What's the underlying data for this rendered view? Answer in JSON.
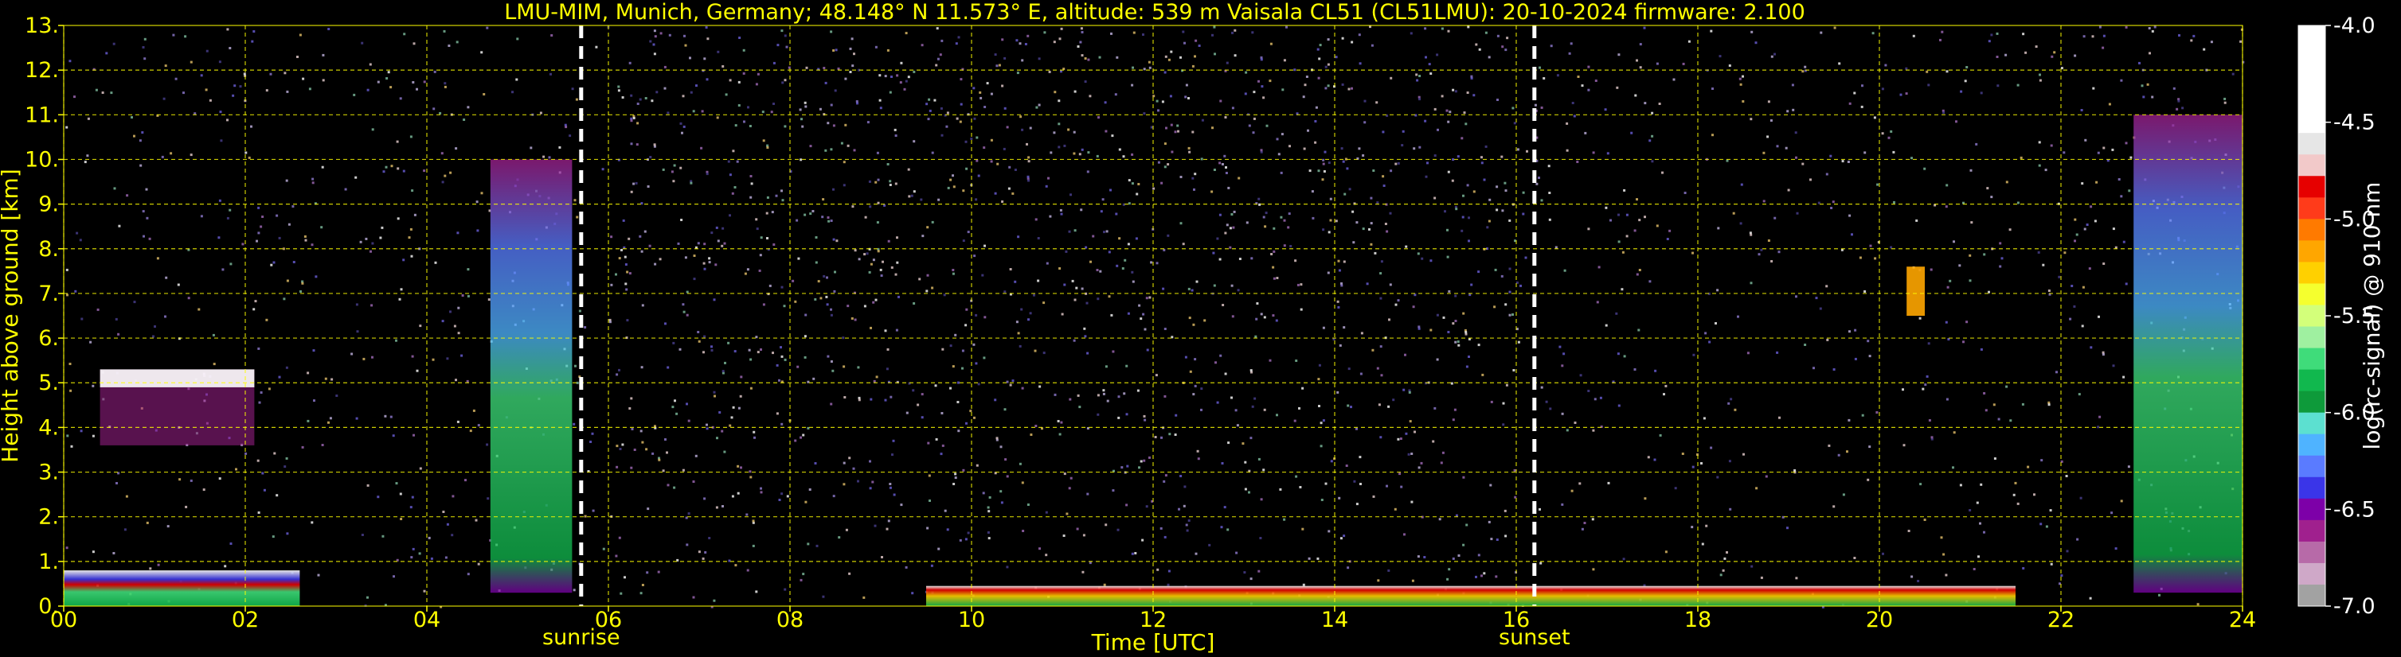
{
  "chart_data": {
    "type": "heatmap",
    "title": "LMU-MIM, Munich, Germany; 48.148° N 11.573° E, altitude: 539 m    Vaisala CL51 (CL51LMU): 20-10-2024    firmware: 2.100",
    "xlabel": "Time [UTC]",
    "ylabel": "Height above ground [km]",
    "xlim": [
      0,
      24
    ],
    "ylim": [
      0,
      13
    ],
    "x_ticks": [
      "00",
      "02",
      "04",
      "06",
      "08",
      "10",
      "12",
      "14",
      "16",
      "18",
      "20",
      "22",
      "24"
    ],
    "y_ticks": [
      "0.",
      "1.",
      "2.",
      "3.",
      "4.",
      "5.",
      "6.",
      "7.",
      "8.",
      "9.",
      "10.",
      "11.",
      "12.",
      "13."
    ],
    "grid": true,
    "markers": [
      {
        "label": "sunrise",
        "time": 5.7
      },
      {
        "label": "sunset",
        "time": 16.2
      }
    ],
    "colorbar": {
      "label": "log(rc-signal) @ 910 nm",
      "range": [
        -7.0,
        -4.0
      ],
      "ticks": [
        "-4.0",
        "-4.5",
        "-5.0",
        "-5.5",
        "-6.0",
        "-6.5",
        "-7.0"
      ],
      "colors": [
        "#ffffff",
        "#ffffff",
        "#ffffff",
        "#ffffff",
        "#ffffff",
        "#e6e6e6",
        "#f2c9c9",
        "#e60000",
        "#ff3b1a",
        "#ff7a00",
        "#ffa600",
        "#ffd000",
        "#f5ff2e",
        "#d3ff7a",
        "#9ff0a0",
        "#3fdc7a",
        "#11b84e",
        "#0e9a3a",
        "#5ce0d0",
        "#4fb3ff",
        "#5a7bff",
        "#3a35e8",
        "#7d00a8",
        "#a0208e",
        "#b76aa8",
        "#cfa8c8",
        "#a2a2a2"
      ]
    },
    "layers": [
      {
        "name": "noise",
        "t0": 0.0,
        "t1": 24.0,
        "h0": 0.0,
        "h1": 13.0,
        "value": -6.4
      },
      {
        "name": "cloud-ice-layer",
        "t0": 0.4,
        "t1": 2.1,
        "h0": 3.6,
        "h1": 5.3,
        "value": -4.9
      },
      {
        "name": "morning-aerosol-column",
        "t0": 4.7,
        "t1": 5.6,
        "h0": 0.3,
        "h1": 10.0,
        "value": -6.0
      },
      {
        "name": "evening-aerosol-column",
        "t0": 22.8,
        "t1": 24.0,
        "h0": 0.3,
        "h1": 11.0,
        "value": -6.0
      },
      {
        "name": "boundary-layer-night",
        "t0": 0.0,
        "t1": 2.6,
        "h0": 0.0,
        "h1": 0.8,
        "value": -5.8
      },
      {
        "name": "boundary-layer-day",
        "t0": 9.5,
        "t1": 21.5,
        "h0": 0.0,
        "h1": 0.45,
        "value": -5.0
      },
      {
        "name": "cloud-2030",
        "t0": 20.3,
        "t1": 20.5,
        "h0": 6.5,
        "h1": 7.6,
        "value": -5.2
      }
    ]
  }
}
